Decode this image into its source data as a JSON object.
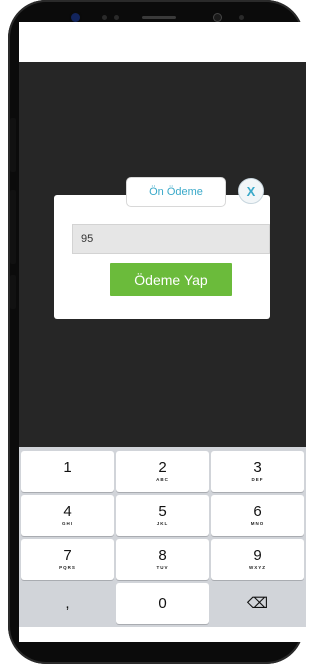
{
  "dialog": {
    "title": "Ön Ödeme",
    "close_label": "X",
    "amount_value": "95",
    "pay_label": "Ödeme Yap"
  },
  "keypad": [
    {
      "num": "1",
      "letters": ""
    },
    {
      "num": "2",
      "letters": "ABC"
    },
    {
      "num": "3",
      "letters": "DEF"
    },
    {
      "num": "4",
      "letters": "GHI"
    },
    {
      "num": "5",
      "letters": "JKL"
    },
    {
      "num": "6",
      "letters": "MNO"
    },
    {
      "num": "7",
      "letters": "PQRS"
    },
    {
      "num": "8",
      "letters": "TUV"
    },
    {
      "num": "9",
      "letters": "WXYZ"
    },
    {
      "num": ",",
      "letters": ""
    },
    {
      "num": "0",
      "letters": ""
    },
    {
      "num": "⌫",
      "letters": ""
    }
  ]
}
